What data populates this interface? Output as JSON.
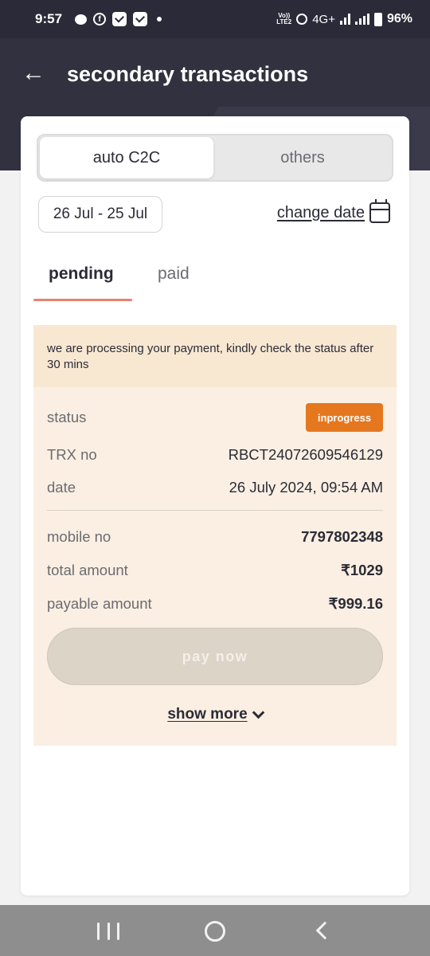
{
  "status_bar": {
    "time": "9:57",
    "volte": "VoLTE2",
    "network": "4G+",
    "battery": "96%"
  },
  "header": {
    "title": "secondary transactions"
  },
  "segment": {
    "options": [
      "auto C2C",
      "others"
    ],
    "selected": "auto C2C"
  },
  "filter": {
    "date_range": "26 Jul - 25 Jul",
    "change_date_label": "change date"
  },
  "tabs": {
    "items": [
      "pending",
      "paid"
    ],
    "active": "pending"
  },
  "notice": "we are processing your payment, kindly check the status after 30 mins",
  "transaction": {
    "status_label": "status",
    "status_value": "inprogress",
    "trx_label": "TRX no",
    "trx_value": "RBCT24072609546129",
    "date_label": "date",
    "date_value": "26 July 2024, 09:54 AM",
    "mobile_label": "mobile no",
    "mobile_value": "7797802348",
    "total_label": "total amount",
    "total_value": "₹1029",
    "payable_label": "payable amount",
    "payable_value": "₹999.16"
  },
  "actions": {
    "pay_now": "pay now",
    "show_more": "show more"
  },
  "colors": {
    "header_bg": "#31313f",
    "accent": "#e8826a",
    "badge": "#e5771e",
    "notice_bg": "#f8e8d2",
    "details_bg": "#faefe2"
  }
}
